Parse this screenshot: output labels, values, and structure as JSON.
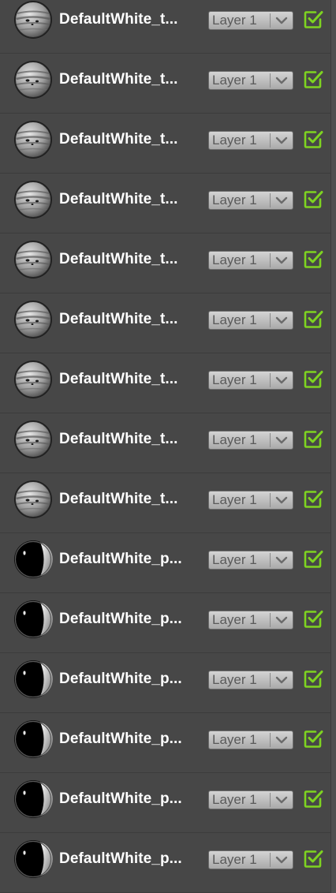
{
  "layers_panel": {
    "items": [
      {
        "name": "DefaultWhite_t...",
        "layer": "Layer 1",
        "visible": true,
        "thumbnail": "striped-sphere-icon"
      },
      {
        "name": "DefaultWhite_t...",
        "layer": "Layer 1",
        "visible": true,
        "thumbnail": "striped-sphere-icon"
      },
      {
        "name": "DefaultWhite_t...",
        "layer": "Layer 1",
        "visible": true,
        "thumbnail": "striped-sphere-icon"
      },
      {
        "name": "DefaultWhite_t...",
        "layer": "Layer 1",
        "visible": true,
        "thumbnail": "striped-sphere-icon"
      },
      {
        "name": "DefaultWhite_t...",
        "layer": "Layer 1",
        "visible": true,
        "thumbnail": "striped-sphere-icon"
      },
      {
        "name": "DefaultWhite_t...",
        "layer": "Layer 1",
        "visible": true,
        "thumbnail": "striped-sphere-icon"
      },
      {
        "name": "DefaultWhite_t...",
        "layer": "Layer 1",
        "visible": true,
        "thumbnail": "striped-sphere-icon"
      },
      {
        "name": "DefaultWhite_t...",
        "layer": "Layer 1",
        "visible": true,
        "thumbnail": "striped-sphere-icon"
      },
      {
        "name": "DefaultWhite_t...",
        "layer": "Layer 1",
        "visible": true,
        "thumbnail": "striped-sphere-icon"
      },
      {
        "name": "DefaultWhite_p...",
        "layer": "Layer 1",
        "visible": true,
        "thumbnail": "glossy-sphere-icon"
      },
      {
        "name": "DefaultWhite_p...",
        "layer": "Layer 1",
        "visible": true,
        "thumbnail": "glossy-sphere-icon"
      },
      {
        "name": "DefaultWhite_p...",
        "layer": "Layer 1",
        "visible": true,
        "thumbnail": "glossy-sphere-icon"
      },
      {
        "name": "DefaultWhite_p...",
        "layer": "Layer 1",
        "visible": true,
        "thumbnail": "glossy-sphere-icon"
      },
      {
        "name": "DefaultWhite_p...",
        "layer": "Layer 1",
        "visible": true,
        "thumbnail": "glossy-sphere-icon"
      },
      {
        "name": "DefaultWhite_p...",
        "layer": "Layer 1",
        "visible": true,
        "thumbnail": "glossy-sphere-icon"
      }
    ]
  },
  "colors": {
    "background": "#474747",
    "checkbox_green": "#7ed321",
    "row_divider": "#3c3c3c"
  }
}
